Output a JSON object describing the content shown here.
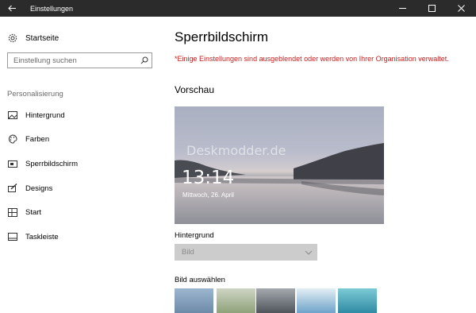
{
  "window": {
    "title": "Einstellungen",
    "back_icon": "back-arrow-icon",
    "controls": [
      "minimize-icon",
      "maximize-icon",
      "close-icon"
    ],
    "titlebar_color": "#2b2b2b"
  },
  "sidebar": {
    "home_label": "Startseite",
    "search_placeholder": "Einstellung suchen",
    "section_label": "Personalisierung",
    "items": [
      {
        "label": "Hintergrund",
        "icon": "picture-icon"
      },
      {
        "label": "Farben",
        "icon": "palette-icon"
      },
      {
        "label": "Sperrbildschirm",
        "icon": "lockscreen-icon",
        "selected": true
      },
      {
        "label": "Designs",
        "icon": "brush-icon"
      },
      {
        "label": "Start",
        "icon": "start-icon"
      },
      {
        "label": "Taskleiste",
        "icon": "taskbar-icon"
      }
    ]
  },
  "main": {
    "title": "Sperrbildschirm",
    "warning": "*Einige Einstellungen sind ausgeblendet oder werden von Ihrer Organisation verwaltet.",
    "warning_color": "#c71b1b",
    "preview_title": "Vorschau",
    "preview": {
      "watermark": "Deskmodder.de",
      "time": "13:14",
      "date": "Mittwoch, 26. April"
    },
    "background_label": "Hintergrund",
    "background_value": "Bild",
    "choose_image_label": "Bild auswählen",
    "thumbnails": [
      "thumb-1",
      "thumb-2",
      "thumb-3",
      "thumb-4",
      "thumb-5"
    ]
  }
}
